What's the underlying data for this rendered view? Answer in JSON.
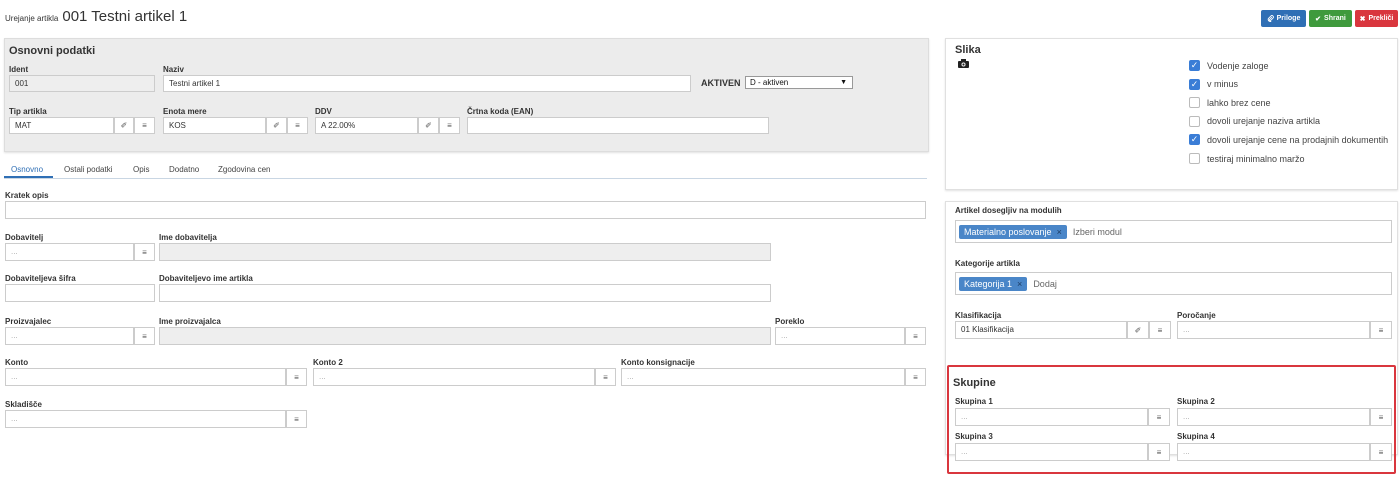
{
  "header": {
    "prefix": "Urejanje artikla",
    "title": "001 Testni artikel 1",
    "buttons": {
      "priloge": "Priloge",
      "shrani": "Shrani",
      "preklici": "Prekliči"
    },
    "colors": {
      "priloge": "#2f6fb5",
      "shrani": "#3f9a3d",
      "preklici": "#d9363e"
    }
  },
  "osnovni": {
    "title": "Osnovni podatki",
    "ident_label": "Ident",
    "ident_value": "001",
    "naziv_label": "Naziv",
    "naziv_value": "Testni artikel 1",
    "aktiven_label": "AKTIVEN",
    "aktiven_value": "D - aktiven",
    "tip_label": "Tip artikla",
    "tip_value": "MAT",
    "enota_label": "Enota mere",
    "enota_value": "KOS",
    "ddv_label": "DDV",
    "ddv_value": "A 22.00%",
    "ean_label": "Črtna koda (EAN)",
    "ean_value": ""
  },
  "tabs": [
    "Osnovno",
    "Ostali podatki",
    "Opis",
    "Dodatno",
    "Zgodovina cen"
  ],
  "active_tab": 0,
  "form": {
    "placeholder": "...",
    "kratek_opis": "Kratek opis",
    "dobavitelj": "Dobavitelj",
    "ime_dobavitelja": "Ime dobavitelja",
    "dobaviteljeva_sifra": "Dobaviteljeva šifra",
    "dobaviteljevo_ime": "Dobaviteljevo ime artikla",
    "proizvajalec": "Proizvajalec",
    "ime_proizvajalca": "Ime proizvajalca",
    "poreklo": "Poreklo",
    "konto": "Konto",
    "konto2": "Konto 2",
    "konto_konsignacije": "Konto konsignacije",
    "skladisce": "Skladišče"
  },
  "slika": {
    "title": "Slika",
    "checkboxes": [
      {
        "label": "Vodenje zaloge",
        "checked": true
      },
      {
        "label": "v minus",
        "checked": true
      },
      {
        "label": "lahko brez cene",
        "checked": false
      },
      {
        "label": "dovoli urejanje naziva artikla",
        "checked": false
      },
      {
        "label": "dovoli urejanje cene na prodajnih dokumentih",
        "checked": true
      },
      {
        "label": "testiraj minimalno maržo",
        "checked": false
      }
    ]
  },
  "moduli": {
    "label": "Artikel dosegljiv na modulih",
    "tag": "Materialno poslovanje",
    "placeholder": "Izberi modul"
  },
  "kategorije": {
    "label": "Kategorije artikla",
    "tag": "Kategorija 1",
    "placeholder": "Dodaj"
  },
  "klasifikacija": {
    "label": "Klasifikacija",
    "value": "01 Klasifikacija",
    "porocanje_label": "Poročanje"
  },
  "skupine": {
    "title": "Skupine",
    "s1": "Skupina 1",
    "s2": "Skupina 2",
    "s3": "Skupina 3",
    "s4": "Skupina 4",
    "highlight_color": "#d9363e"
  },
  "misc": {
    "tag_remove": "×",
    "list_icon": "≡"
  }
}
